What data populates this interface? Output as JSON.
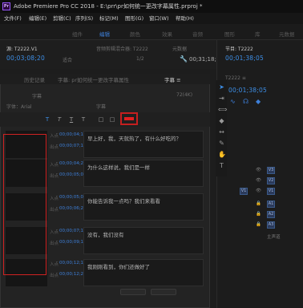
{
  "titlebar": {
    "app_icon_text": "Pr",
    "title": "Adobe Premiere Pro CC 2018 - E:\\prr\\pr如何统一更改字幕属性.prproj *"
  },
  "menu": {
    "items": [
      "文件(F)",
      "编辑(E)",
      "剪辑(C)",
      "序列(S)",
      "标记(M)",
      "图形(G)",
      "窗口(W)",
      "帮助(H)"
    ]
  },
  "workspaces": {
    "items": [
      "组件",
      "编辑",
      "颜色",
      "效果",
      "音频",
      "图形",
      "库",
      "元数据"
    ],
    "active_index": 1
  },
  "source": {
    "tab_label": "源: T2222.V1",
    "timecode": "00;03;08;20",
    "fit_label": "适合",
    "clip_label": "音频剪辑混合器: T2222",
    "scale_label": "1/2",
    "duration": "00;31;18;07",
    "duration_label": "元数据",
    "duration_icon": "wrench-icon"
  },
  "program": {
    "tab_label": "节目: T2222",
    "timecode": "00;01;38;05",
    "sequence_label": "T2222 ≡",
    "timeline_tc": "00;01;38;05",
    "tools_labels": [
      "∿",
      "☊",
      "◆"
    ]
  },
  "caption_panel": {
    "tabs": [
      "历史记录",
      "字幕: pr如何统一更改字幕属性",
      "字幕 ≡",
      "字幕 ≡"
    ],
    "active_tab": 2,
    "style_label": "字幕",
    "font_label": "字体：Arial",
    "style_value": "字幕",
    "size_value": "72(4K)",
    "format_icons": [
      "T",
      "T",
      "T",
      "T",
      "T"
    ],
    "format_extra": [
      "□",
      "□"
    ],
    "color_swatch": "#e02020"
  },
  "captions": [
    {
      "in_label": "入点",
      "in_tc": "00;00;04;12",
      "out_label": "出点",
      "out_tc": "00;00;07;19",
      "text": "早上好，我，天就热了，有什么好吃的？"
    },
    {
      "in_label": "入点",
      "in_tc": "00;00;04;22",
      "out_label": "出点",
      "out_tc": "00;00;05;00",
      "text": "为什么这样说，我们是一样"
    },
    {
      "in_label": "入点",
      "in_tc": "00;00;05;04",
      "out_label": "出点",
      "out_tc": "00;00;06;25",
      "text": "你能告诉我一点吗？我们来看看"
    },
    {
      "in_label": "入点",
      "in_tc": "00;00;07;18",
      "out_label": "出点",
      "out_tc": "00;00;09;12",
      "text": "没有，我们没有"
    },
    {
      "in_label": "入点",
      "in_tc": "00;00;12;16",
      "out_label": "出点",
      "out_tc": "00;00;12;21",
      "text": "我刚刚看到，你们还做好了"
    }
  ],
  "tracks": {
    "rows": [
      {
        "label": "V3",
        "btn": "V3"
      },
      {
        "label": "V2",
        "btn": "V2"
      },
      {
        "label": "V1",
        "btn": "V1"
      },
      {
        "label": "A1",
        "btn": "A1"
      },
      {
        "label": "A2",
        "btn": "A2"
      },
      {
        "label": "A3",
        "btn": "A3"
      },
      {
        "label": "主声道",
        "btn": "主"
      }
    ]
  },
  "colors": {
    "accent_blue": "#3d8ee6",
    "highlight_red": "#d02222"
  }
}
